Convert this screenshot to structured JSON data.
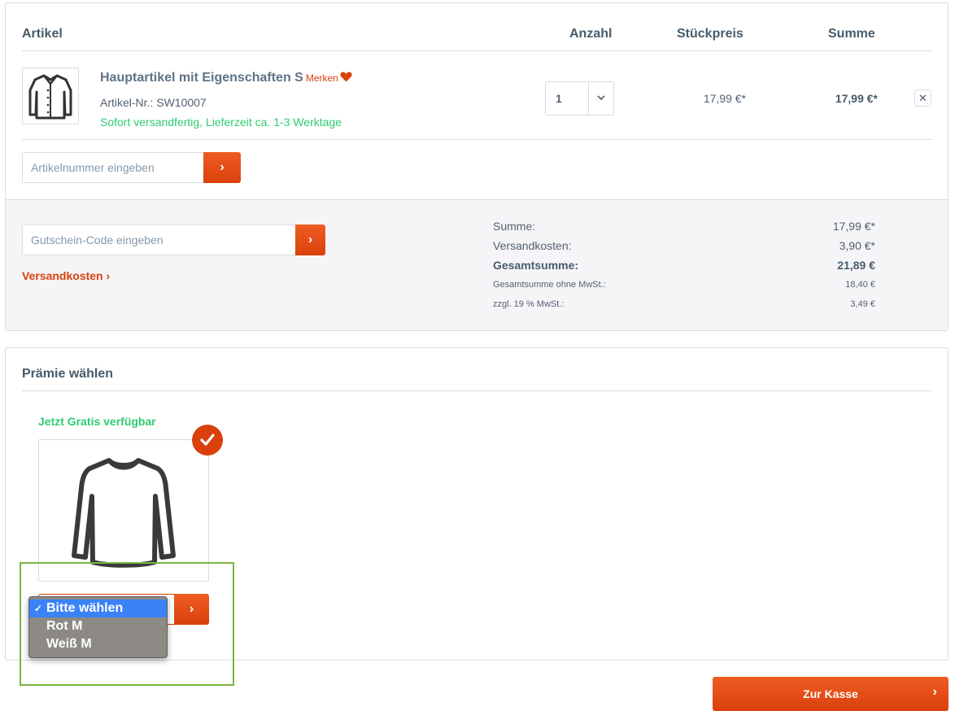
{
  "cart": {
    "headers": {
      "article": "Artikel",
      "quantity": "Anzahl",
      "unit_price": "Stückpreis",
      "total": "Summe"
    },
    "item": {
      "name": "Hauptartikel mit Eigenschaften S",
      "merken": "Merken",
      "sku": "Artikel-Nr.: SW10007",
      "delivery": "Sofort versandfertig, Lieferzeit ca. 1-3 Werktage",
      "quantity": "1",
      "unit_price": "17,99 €*",
      "total": "17,99 €*",
      "remove_label": "✕",
      "image_icon": "shirt-icon"
    },
    "article_input": {
      "placeholder": "Artikelnummer eingeben",
      "button_label": "›"
    },
    "voucher_input": {
      "placeholder": "Gutschein-Code eingeben",
      "button_label": "›"
    },
    "shipping_link": "Versandkosten ›",
    "summary": {
      "sum_label": "Summe:",
      "sum_value": "17,99 €*",
      "shipping_label": "Versandkosten:",
      "shipping_value": "3,90 €*",
      "grand_label": "Gesamtsumme:",
      "grand_value": "21,89 €",
      "net_label": "Gesamtsumme ohne MwSt.:",
      "net_value": "18,40 €",
      "tax_label": "zzgl. 19 % MwSt.:",
      "tax_value": "3,49 €"
    }
  },
  "bonus": {
    "title": "Prämie wählen",
    "free_label": "Jetzt Gratis verfügbar",
    "image_icon": "longsleeve-icon",
    "dropdown": {
      "options": [
        "Bitte wählen",
        "Rot M",
        "Weiß M"
      ],
      "selected_index": 0,
      "check_mark": "✓"
    },
    "add_button_label": "›"
  },
  "checkout": {
    "label": "Zur Kasse",
    "arrow": "›"
  },
  "colors": {
    "accent": "#d9400b",
    "success": "#2ecc71",
    "text": "#52606f",
    "border": "#dadae5",
    "highlight": "#7cb342",
    "dropdown_selected": "#3b82f6"
  }
}
